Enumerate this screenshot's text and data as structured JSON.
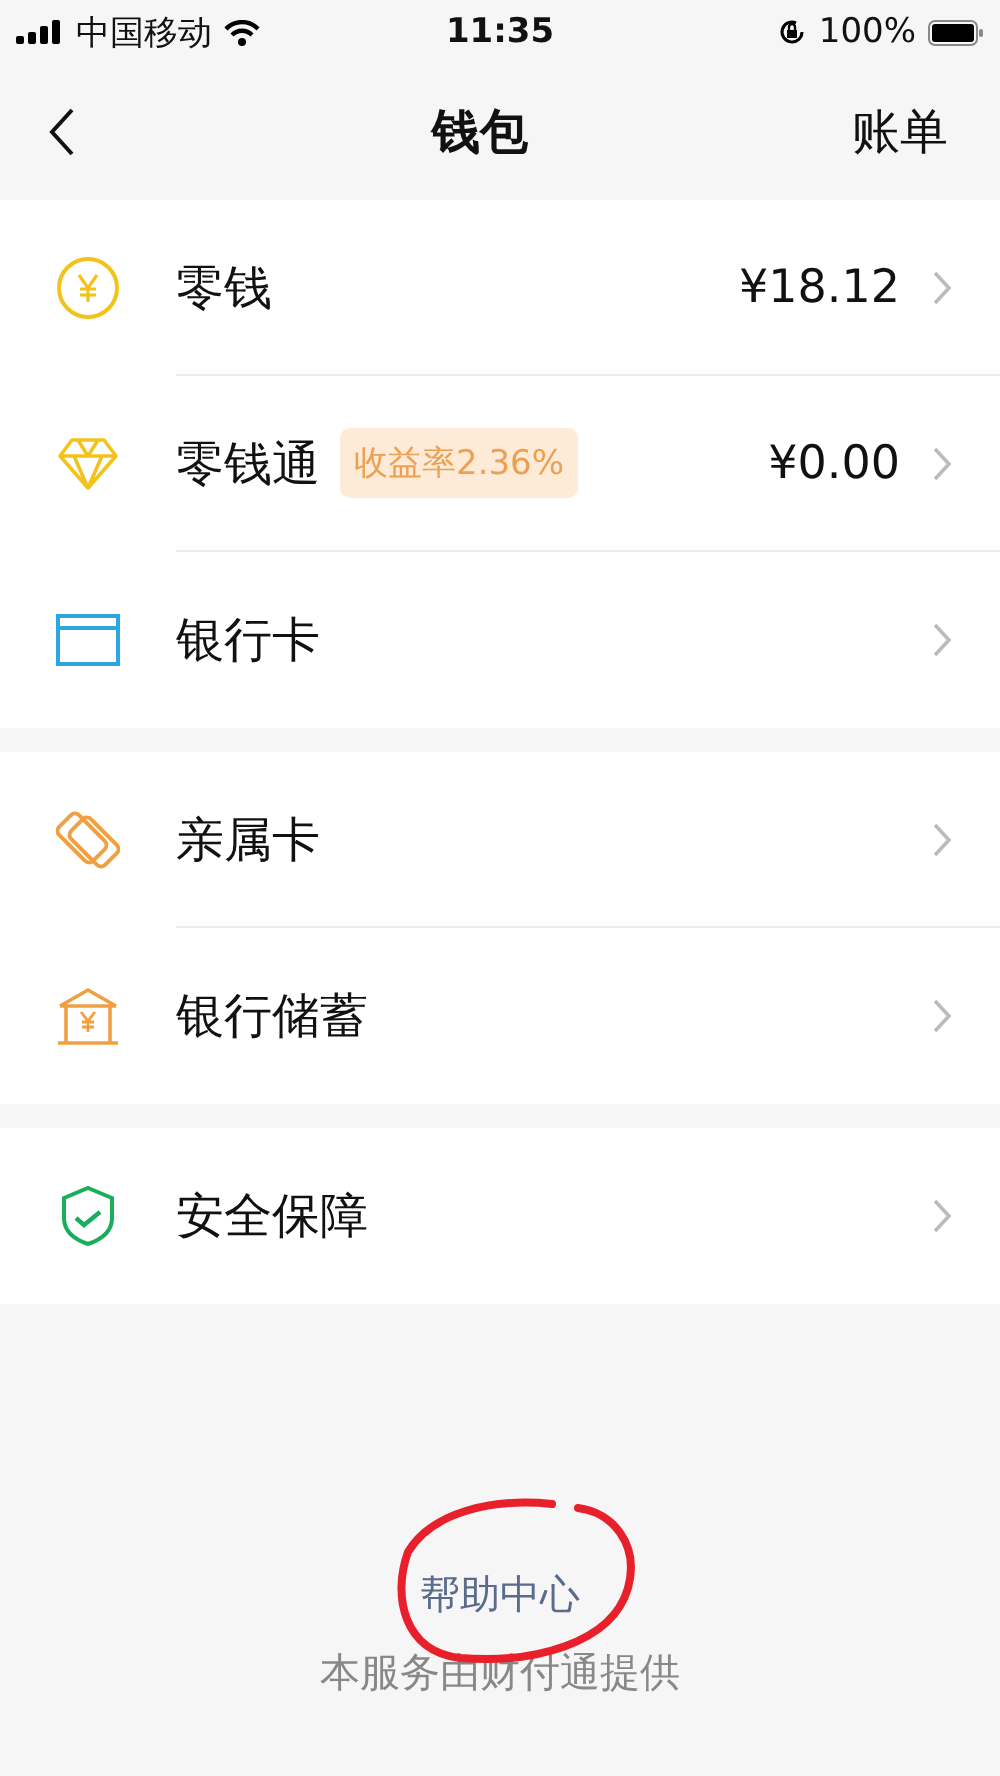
{
  "status_bar": {
    "carrier": "中国移动",
    "time": "11:35",
    "battery": "100%"
  },
  "nav": {
    "title": "钱包",
    "action": "账单"
  },
  "sections": [
    {
      "items": [
        {
          "kind": "coin",
          "label": "零钱",
          "value": "¥18.12"
        },
        {
          "kind": "diamond",
          "label": "零钱通",
          "badge": "收益率2.36%",
          "value": "¥0.00"
        },
        {
          "kind": "card",
          "label": "银行卡"
        }
      ]
    },
    {
      "items": [
        {
          "kind": "family",
          "label": "亲属卡"
        },
        {
          "kind": "bank",
          "label": "银行储蓄"
        }
      ]
    },
    {
      "items": [
        {
          "kind": "shield",
          "label": "安全保障"
        }
      ]
    }
  ],
  "footer": {
    "help": "帮助中心",
    "provider": "本服务由财付通提供"
  }
}
